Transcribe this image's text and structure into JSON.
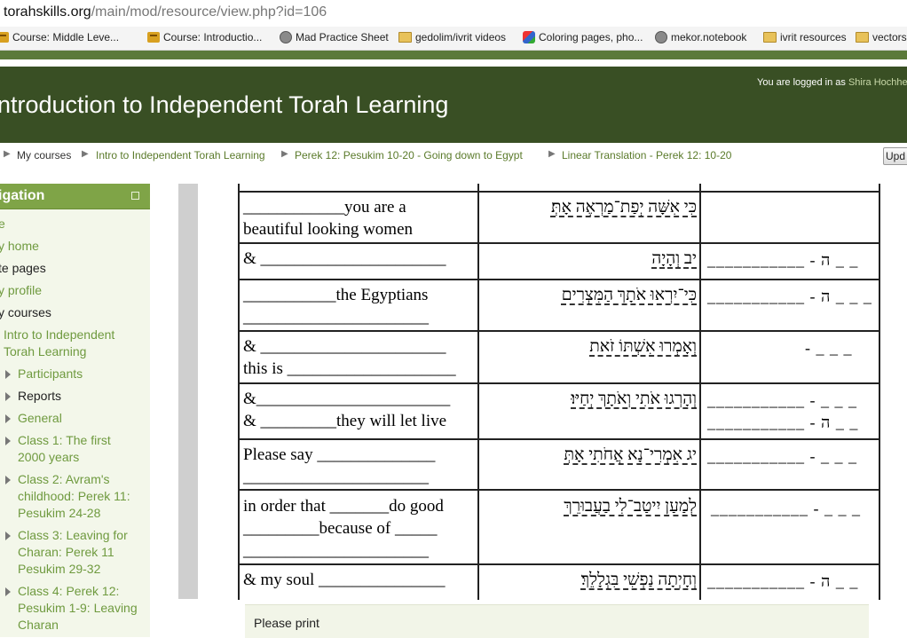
{
  "browser": {
    "url_host": "torahskills.org",
    "url_path": "/main/mod/resource/view.php?id=106"
  },
  "bookmarks": [
    {
      "label": "Course: Middle Leve...",
      "icon": "course-icon"
    },
    {
      "label": "Course: Introductio...",
      "icon": "course-icon"
    },
    {
      "label": "Mad Practice Sheet",
      "icon": "globe-icon"
    },
    {
      "label": "gedolim/ivrit videos",
      "icon": "folder-icon"
    },
    {
      "label": "Coloring pages, pho...",
      "icon": "coloring-icon"
    },
    {
      "label": "mekor.notebook",
      "icon": "globe-icon"
    },
    {
      "label": "ivrit resources",
      "icon": "folder-icon"
    },
    {
      "label": "vectors",
      "icon": "folder-icon"
    }
  ],
  "header": {
    "title": "ntroduction to Independent Torah Learning",
    "login_prefix": "You are logged in as",
    "user": "Shira Hochhe"
  },
  "breadcrumb": [
    "My courses",
    "Intro to Independent Torah Learning",
    "Perek 12: Pesukim 10-20 - Going down to Egypt",
    "Linear Translation - Perek 12: 10-20"
  ],
  "update_button": "Upd",
  "navigation": {
    "title": "igation",
    "items": [
      "e",
      "y home",
      "te pages",
      "y profile",
      "y courses",
      "Intro to Independent",
      "Torah Learning",
      "Participants",
      "Reports",
      "General",
      "Class 1: The first",
      "2000 years",
      "Class 2: Avram's",
      "childhood: Perek 11:",
      "Pesukim 24-28",
      "Class 3: Leaving for",
      "Charan: Perek 11",
      "Pesukim 29-32",
      "Class 4: Perek 12:",
      "Pesukim 1-9: Leaving",
      "Charan"
    ]
  },
  "worksheet": {
    "rows": [
      {
        "en": [
          "____________you are a",
          "beautiful looking women"
        ],
        "he": "כִּי אִשָּׁה יְפַת־מַרְאֶה אָתְּ׃",
        "tr": []
      },
      {
        "en": [
          "& ______________________"
        ],
        "he": "יב וְהָיָה",
        "tr": [
          "___________ - ה  _ _"
        ]
      },
      {
        "en": [
          "___________the Egyptians",
          "______________________"
        ],
        "he": "כִּי־יִרְאוּ אֹתָךְ הַמִּצְרִים",
        "tr": [
          "___________ - ה  _ _ _"
        ]
      },
      {
        "en": [
          "& ______________________",
          "this is ____________________"
        ],
        "he": "וְאָמְרוּ אִשְׁתּוֹ זֹאת",
        "tr": [
          "- _ _ _"
        ]
      },
      {
        "en": [
          "&_______________________",
          "& _________they will let live"
        ],
        "he": "וְהָרְגוּ אֹתִי וְאֹתָךְ יְחַיּוּ׃",
        "tr": [
          "___________ - _ _ _",
          "___________ - ה  _ _"
        ]
      },
      {
        "en": [
          "Please say ______________",
          "______________________"
        ],
        "he": "יג אִמְרִי־נָא אֲחֹתִי אָתְּ",
        "tr": [
          "___________ - _ _ _"
        ]
      },
      {
        "en": [
          "in order that _______do good",
          "_________because of _____",
          "______________________"
        ],
        "he": "לְמַעַן יִיטַב־לִי בַעֲבוּרֵךְ",
        "tr": [
          "___________ - _ _ _"
        ]
      },
      {
        "en": [
          "& my soul _______________",
          "___________________"
        ],
        "he": "וְחָיְתָה נַפְשִׁי בִּגְלָלֵךְ׃",
        "tr": [
          "___________ - ה  _ _"
        ]
      }
    ]
  },
  "print_note": "Please print"
}
